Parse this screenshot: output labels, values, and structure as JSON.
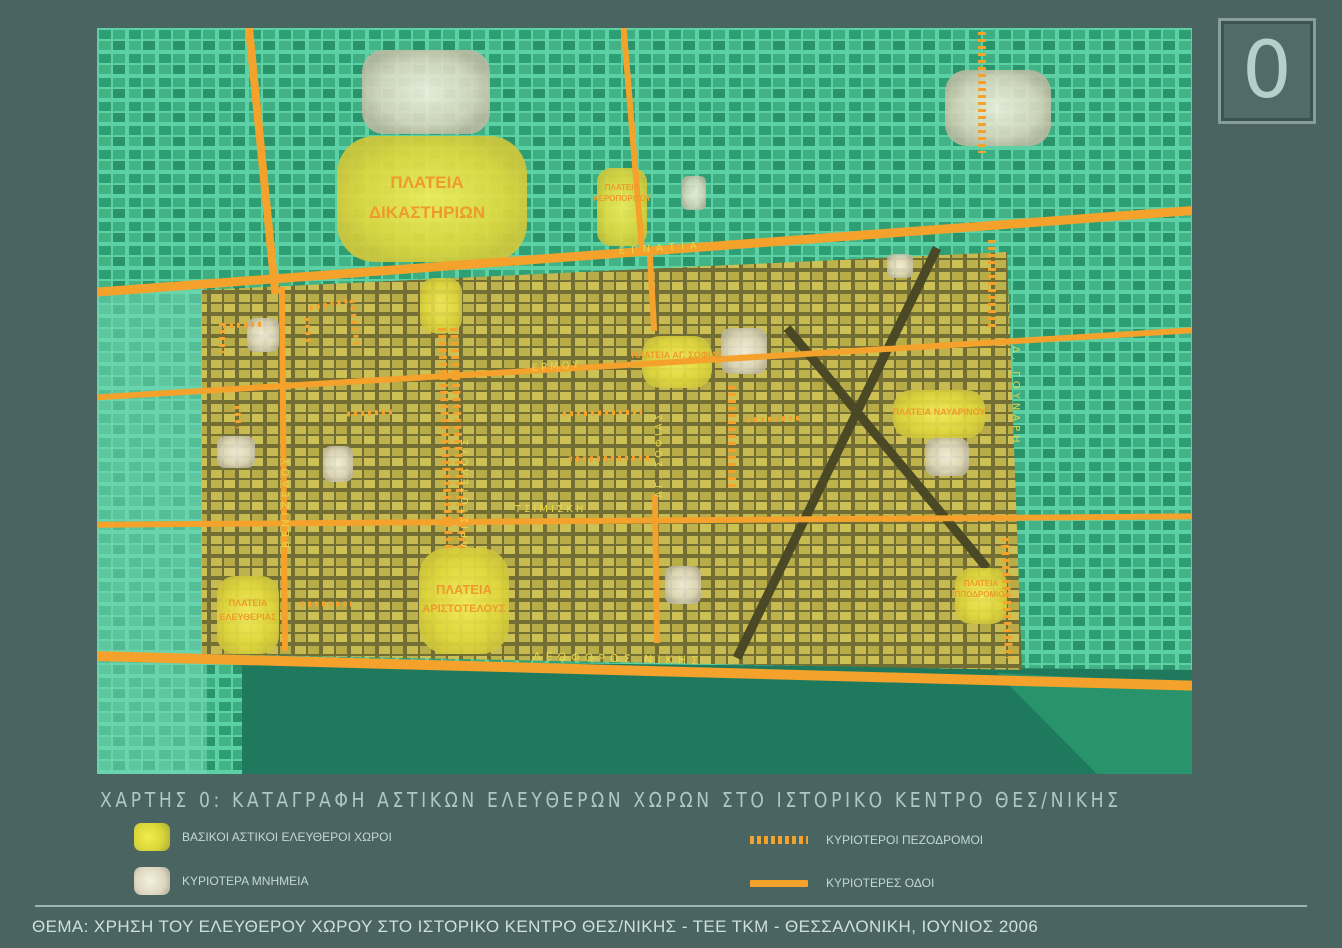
{
  "map_number": "0",
  "title": "ΧΑΡΤΗΣ 0: ΚΑΤΑΓΡΑΦΗ ΑΣΤΙΚΩΝ ΕΛΕΥΘΕΡΩΝ ΧΩΡΩΝ ΣΤΟ ΙΣΤΟΡΙΚΟ ΚΕΝΤΡΟ ΘΕΣ/ΝΙΚΗΣ",
  "legend": {
    "open_spaces": "ΒΑΣΙΚΟΙ ΑΣΤΙΚΟΙ ΕΛΕΥΘΕΡΟΙ ΧΩΡΟΙ",
    "monuments": "ΚΥΡΙΟΤΕΡΑ ΜΝΗΜΕΙΑ",
    "pedestrian_streets": "ΚΥΡΙΟΤΕΡΟΙ ΠΕΖΟΔΡΟΜΟΙ",
    "main_roads": "ΚΥΡΙΟΤΕΡΕΣ ΟΔΟΙ"
  },
  "streets": {
    "egnatia": "ΕΓΝΑΤΙΑ",
    "ermou": "ΕΡΜΟΥ",
    "tsimiski": "ΤΣΙΜΙΣΚΗ",
    "nikis": "ΛΕΩΦΟΡΟΣ ΝΙΚΗΣ",
    "venizelou": "ΒΕΝΙΖΕΛΟΥ",
    "aristotelous": "ΑΡΙΣΤΟΤΕΛΟΥΣ",
    "agias_sofias": "ΑΓ. ΣΟΦΙΑΣ",
    "gounari": "Δ. ΓΟΥΝΑΡΗ"
  },
  "squares": {
    "dikastirion_line1": "ΠΛΑΤΕΙΑ",
    "dikastirion_line2": "ΔΙΚΑΣΤΗΡΙΩΝ",
    "aeropoliton_line1": "ΠΛΑΤΕΙΑ",
    "aeropoliton_line2": "ΑΕΡΟΠΟΡΙΤΟΥ",
    "agias_sofias": "ΠΛΑΤΕΙΑ ΑΓ. ΣΟΦΙΑΣ",
    "navarinou": "ΠΛΑΤΕΙΑ ΝΑΥΑΡΙΝΟΥ",
    "eleftherias_line1": "ΠΛΑΤΕΙΑ",
    "eleftherias_line2": "ΕΛΕΥΘΕΡΙΑΣ",
    "aristotelous_line1": "ΠΛΑΤΕΙΑ",
    "aristotelous_line2": "ΑΡΙΣΤΟΤΕΛΟΥΣ",
    "ippodromiou_line1": "ΠΛΑΤΕΙΑ",
    "ippodromiou_line2": "ΙΠΠΟΔΡΟΜΙΟΥ"
  },
  "footer": "ΘΕΜΑ: ΧΡΗΣΗ ΤΟΥ ΕΛΕΥΘΕΡΟΥ ΧΩΡΟΥ ΣΤΟ ΙΣΤΟΡΙΚΟ ΚΕΝΤΡΟ ΘΕΣ/ΝΙΚΗΣ - ΤΕΕ ΤΚΜ - ΘΕΣΣΑΛΟΝΙΚΗ, ΙΟΥΝΙΟΣ 2006",
  "colors": {
    "background": "#4a6461",
    "city": "#2b9c73",
    "historic_center": "#c2b64a",
    "sea": "#1f7a5d",
    "road": "#f4a22c",
    "open_space": "#efe548",
    "monument": "#e6e1c9"
  }
}
